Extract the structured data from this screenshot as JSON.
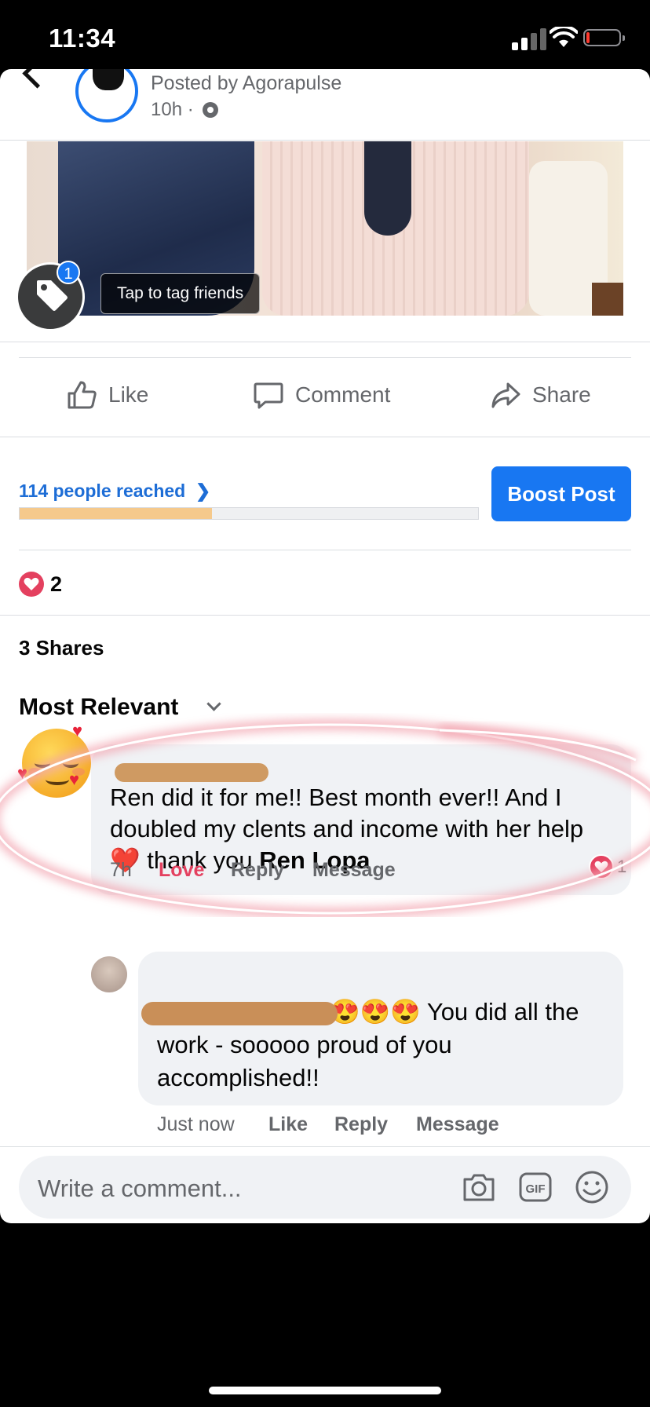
{
  "status_bar": {
    "time": "11:34"
  },
  "post": {
    "posted_by": "Posted by Agorapulse",
    "time": "10h ·",
    "tag_tip": "Tap to tag friends",
    "tag_badge": "1"
  },
  "actions": {
    "like": "Like",
    "comment": "Comment",
    "share": "Share"
  },
  "insights": {
    "reached": "114 people reached",
    "reach_progress": 0.42,
    "boost": "Boost Post"
  },
  "reactions": {
    "count": "2"
  },
  "shares": "3 Shares",
  "sort": {
    "label": "Most Relevant"
  },
  "comments": [
    {
      "text": "Ren did it for me!! Best month ever!! And I doubled my clents and income with her help",
      "emoji": "❤️",
      "text_end": "thank you",
      "mention": "Ren Lopa",
      "time": "7h",
      "love": "Love",
      "reply": "Reply",
      "message": "Message",
      "reaction_count": "1"
    },
    {
      "emojis": "😍😍😍",
      "text": "You did all the work - sooooo proud of you accomplished!!",
      "time": "Just now",
      "like": "Like",
      "reply": "Reply",
      "message": "Message"
    }
  ],
  "composer": {
    "placeholder": "Write a comment..."
  }
}
